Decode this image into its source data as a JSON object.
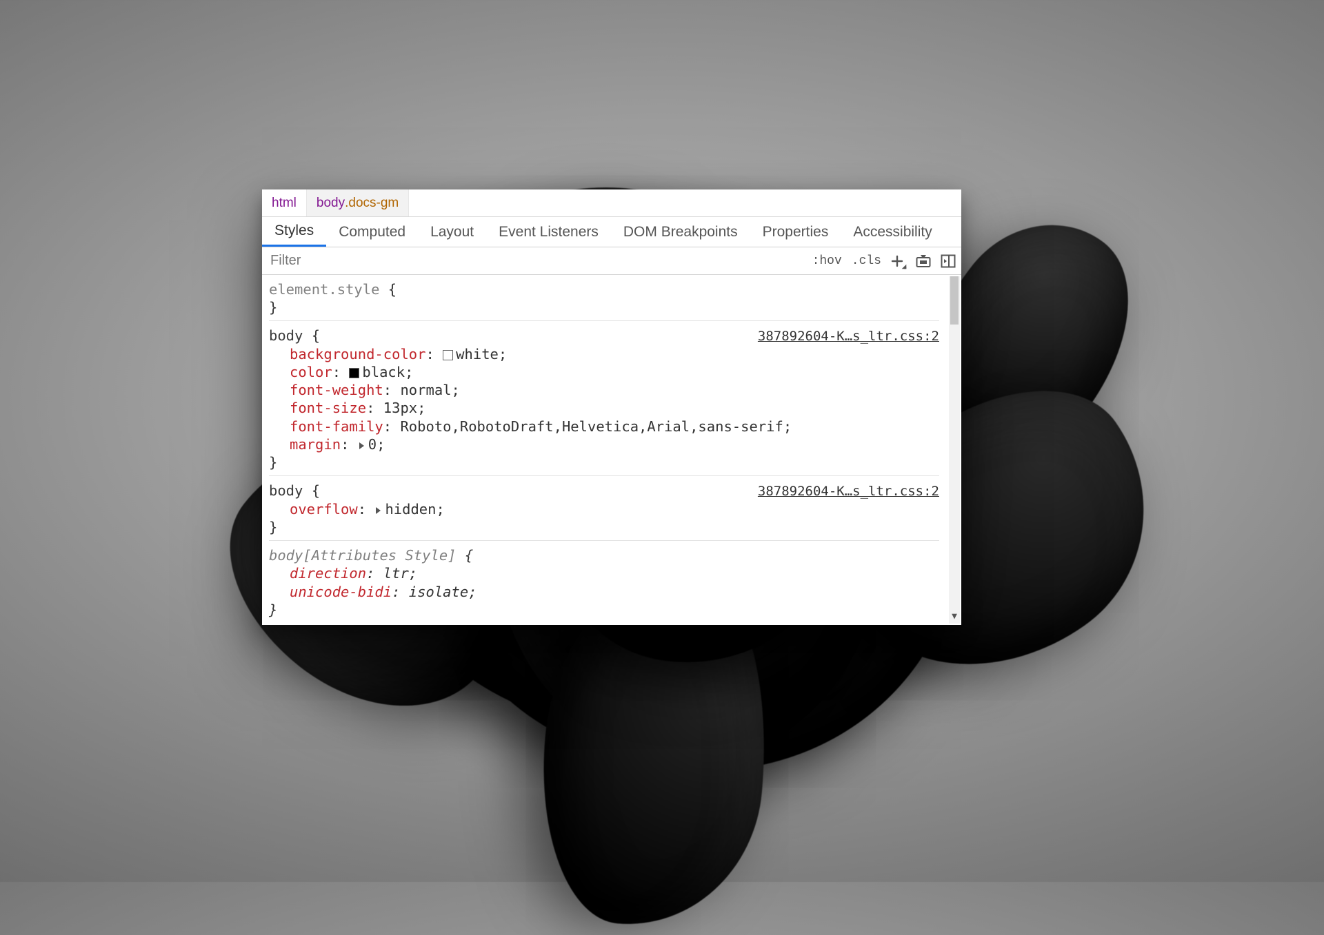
{
  "breadcrumbs": [
    {
      "tag": "html",
      "cls": ""
    },
    {
      "tag": "body",
      "cls": ".docs-gm"
    }
  ],
  "tabs": [
    "Styles",
    "Computed",
    "Layout",
    "Event Listeners",
    "DOM Breakpoints",
    "Properties",
    "Accessibility"
  ],
  "active_tab": 0,
  "filter": {
    "placeholder": "Filter",
    "value": ""
  },
  "toolbar": {
    "hov": ":hov",
    "cls": ".cls"
  },
  "rules": [
    {
      "selector": "element.style",
      "selector_gray": true,
      "origin": "",
      "italic": false,
      "decls": []
    },
    {
      "selector": "body",
      "selector_gray": false,
      "origin": "387892604-K…s_ltr.css:2",
      "italic": false,
      "decls": [
        {
          "prop": "background-color",
          "val": "white",
          "swatch": "white"
        },
        {
          "prop": "color",
          "val": "black",
          "swatch": "black"
        },
        {
          "prop": "font-weight",
          "val": "normal"
        },
        {
          "prop": "font-size",
          "val": "13px"
        },
        {
          "prop": "font-family",
          "val": "Roboto,RobotoDraft,Helvetica,Arial,sans-serif"
        },
        {
          "prop": "margin",
          "val": "0",
          "expand": true
        }
      ]
    },
    {
      "selector": "body",
      "selector_gray": false,
      "origin": "387892604-K…s_ltr.css:2",
      "italic": false,
      "decls": [
        {
          "prop": "overflow",
          "val": "hidden",
          "expand": true
        }
      ]
    },
    {
      "selector": "body[Attributes Style]",
      "selector_gray": true,
      "origin": "",
      "italic": true,
      "decls": [
        {
          "prop": "direction",
          "val": "ltr"
        },
        {
          "prop": "unicode-bidi",
          "val": "isolate"
        }
      ]
    }
  ]
}
